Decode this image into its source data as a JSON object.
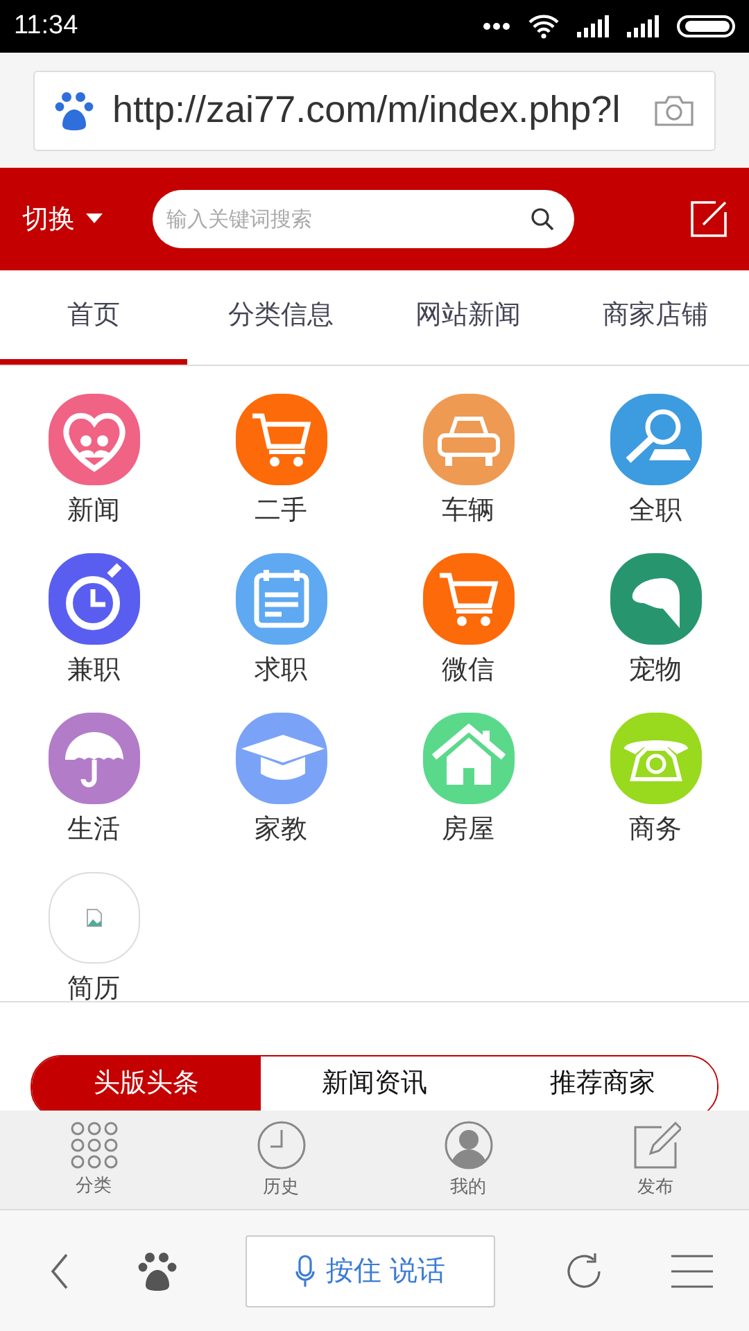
{
  "status_bar": {
    "time": "11:34"
  },
  "address_bar": {
    "url": "http://zai77.com/m/index.php?l"
  },
  "header": {
    "switch_label": "切换",
    "search": {
      "placeholder": "输入关键词搜索"
    }
  },
  "tabs": [
    {
      "label": "首页",
      "selected": true
    },
    {
      "label": "分类信息",
      "selected": false
    },
    {
      "label": "网站新闻",
      "selected": false
    },
    {
      "label": "商家店铺",
      "selected": false
    }
  ],
  "categories": [
    {
      "label": "新闻",
      "kind": "icon",
      "color": "#f06384"
    },
    {
      "label": "二手",
      "kind": "icon",
      "color": "#fd6a0a"
    },
    {
      "label": "车辆",
      "kind": "icon",
      "color": "#ee9a53"
    },
    {
      "label": "全职",
      "kind": "icon",
      "color": "#3d9be0"
    },
    {
      "label": "兼职",
      "kind": "icon",
      "color": "#5a5ef0"
    },
    {
      "label": "求职",
      "kind": "icon",
      "color": "#5fa8f2"
    },
    {
      "label": "微信",
      "kind": "icon",
      "color": "#fd6a0a"
    },
    {
      "label": "宠物",
      "kind": "icon",
      "color": "#27966e"
    },
    {
      "label": "生活",
      "kind": "icon",
      "color": "#b27cc9"
    },
    {
      "label": "家教",
      "kind": "icon",
      "color": "#7aa3f7"
    },
    {
      "label": "房屋",
      "kind": "icon",
      "color": "#5ad98b"
    },
    {
      "label": "商务",
      "kind": "icon",
      "color": "#99d91e"
    },
    {
      "label": "简历",
      "kind": "missing-image"
    }
  ],
  "segments": [
    {
      "label": "头版头条",
      "selected": true
    },
    {
      "label": "新闻资讯",
      "selected": false
    },
    {
      "label": "推荐商家",
      "selected": false
    }
  ],
  "bottom_nav": [
    {
      "label": "分类"
    },
    {
      "label": "历史"
    },
    {
      "label": "我的"
    },
    {
      "label": "发布"
    }
  ],
  "browser_bar": {
    "voice_button": "按住 说话"
  }
}
